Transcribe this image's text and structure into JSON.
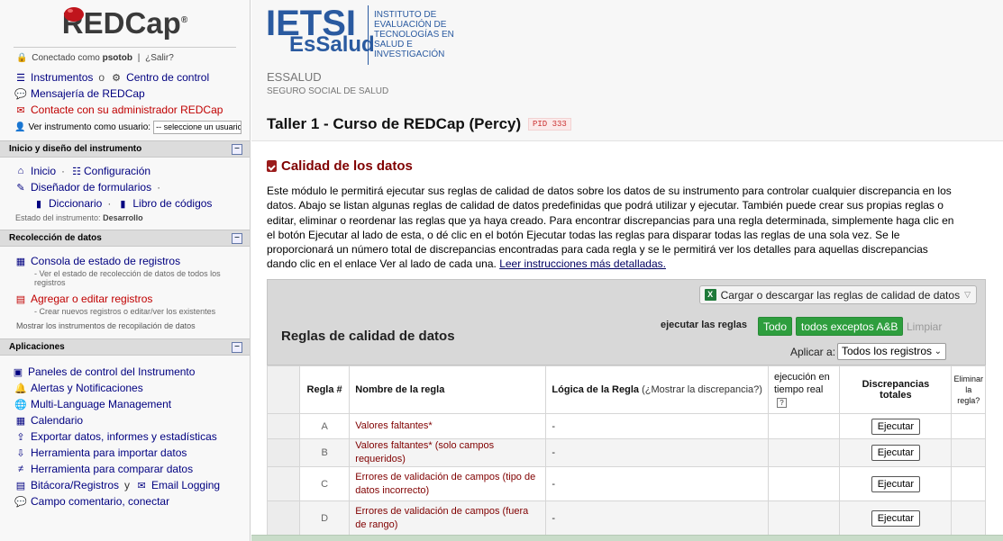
{
  "sidebar": {
    "logo": "REDCap",
    "logo_reg": "®",
    "connected_prefix": "Conectado como",
    "username": "psotob",
    "separator": "|",
    "logout": "¿Salir?",
    "top_links": {
      "instruments": "Instrumentos",
      "or": "o",
      "control_center": "Centro de control",
      "messenger": "Mensajería de REDCap",
      "contact_admin": "Contacte con su administrador REDCap"
    },
    "view_as_label": "Ver instrumento como usuario:",
    "view_as_value": "-- seleccione un usuario --",
    "sections": {
      "home": {
        "title": "Inicio y diseño del instrumento",
        "home_link": "Inicio",
        "config_link": "Configuración",
        "designer": "Diseñador de formularios",
        "dictionary": "Diccionario",
        "codebook": "Libro de códigos",
        "status_label": "Estado del instrumento:",
        "status_value": "Desarrollo"
      },
      "data_collection": {
        "title": "Recolección de datos",
        "status_dashboard": "Consola de estado de registros",
        "status_dashboard_note": "- Ver el estado de recolección de datos de todos los registros",
        "add_edit": "Agregar o editar registros",
        "add_edit_note": "- Crear nuevos registros o editar/ver los existentes",
        "show_tools": "Mostrar los instrumentos de recopilación de datos"
      },
      "applications": {
        "title": "Aplicaciones",
        "items": [
          "Paneles de control del Instrumento",
          "Alertas y Notificaciones",
          "Multi-Language Management",
          "Calendario",
          "Exportar datos, informes y estadísticas",
          "Herramienta para importar datos",
          "Herramienta para comparar datos",
          "Bitácora/Registros",
          "y",
          "Email Logging",
          "Campo comentario, conectar"
        ]
      }
    }
  },
  "header": {
    "org_logo_big": "IETSI",
    "org_logo_small": "EsSalud",
    "institute_text": "INSTITUTO DE EVALUACIÓN DE TECNOLOGÍAS EN SALUD E INVESTIGACIÓN",
    "org_name": "ESSALUD",
    "org_subname": "SEGURO SOCIAL DE SALUD",
    "project_title": "Taller 1 - Curso de REDCap (Percy)",
    "pid": "PID 333"
  },
  "page": {
    "title": "Calidad de los datos",
    "description": "Este módulo le permitirá ejecutar sus reglas de calidad de datos sobre los datos de su instrumento para controlar cualquier discrepancia en los datos. Abajo se listan algunas reglas de calidad de datos predefinidas que podrá utilizar y ejecutar. También puede crear sus propias reglas o editar, eliminar o reordenar las reglas que ya haya creado. Para encontrar discrepancias para una regla determinada, simplemente haga clic en el botón Ejecutar al lado de esta, o dé clic en el botón Ejecutar todas las reglas para disparar todas las reglas de una sola vez. Se le proporcionará un número total de discrepancias encontradas para cada regla y se le permitirá ver los detalles para aquellas discrepancias dando clic en el enlace Ver al lado de cada una.",
    "instructions_link": "Leer instrucciones más detalladas."
  },
  "panel": {
    "download_label": "Cargar o descargar las reglas de calidad de datos",
    "title": "Reglas de calidad de datos",
    "exec_label": "ejecutar las reglas",
    "btn_all": "Todo",
    "btn_except": "todos exceptos A&B",
    "clear": "Limpiar",
    "apply_label": "Aplicar a:",
    "apply_value": "Todos los registros"
  },
  "table": {
    "headers": {
      "rule": "Regla #",
      "name": "Nombre de la regla",
      "logic": "Lógica de la Regla",
      "logic_show": "(¿Mostrar la discrepancia?)",
      "realtime": "ejecución en tiempo real",
      "realtime_help": "?",
      "total": "Discrepancias totales",
      "delete": "Eliminar la regla?"
    },
    "rows": [
      {
        "letter": "A",
        "name": "Valores faltantes*",
        "logic": "-",
        "action": "Ejecutar"
      },
      {
        "letter": "B",
        "name": "Valores faltantes* (solo campos requeridos)",
        "logic": "-",
        "action": "Ejecutar"
      },
      {
        "letter": "C",
        "name": "Errores de validación de campos (tipo de datos incorrecto)",
        "logic": "-",
        "action": "Ejecutar"
      },
      {
        "letter": "D",
        "name": "Errores de validación de campos (fuera de rango)",
        "logic": "-",
        "action": "Ejecutar"
      }
    ]
  },
  "colors": {
    "brand_blue": "#2a5aa0",
    "title_maroon": "#800000",
    "green_button": "#2e9e3e",
    "link_navy": "#000080"
  }
}
